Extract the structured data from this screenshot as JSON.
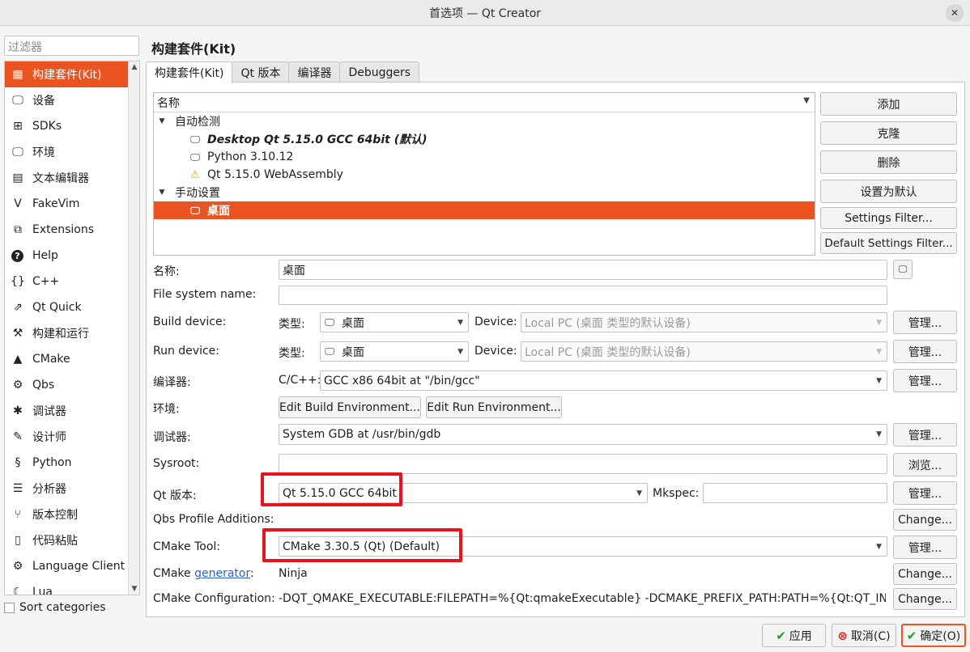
{
  "window": {
    "title": "首选项 — Qt Creator"
  },
  "sidebar": {
    "filter_placeholder": "过滤器",
    "items": [
      {
        "label": "构建套件(Kit)",
        "icon": "kit-icon",
        "selected": true
      },
      {
        "label": "设备",
        "icon": "device-icon"
      },
      {
        "label": "SDKs",
        "icon": "grid-icon"
      },
      {
        "label": "环境",
        "icon": "monitor-icon"
      },
      {
        "label": "文本编辑器",
        "icon": "text-editor-icon"
      },
      {
        "label": "FakeVim",
        "icon": "fakevim-icon"
      },
      {
        "label": "Extensions",
        "icon": "extensions-icon"
      },
      {
        "label": "Help",
        "icon": "help-icon"
      },
      {
        "label": "C++",
        "icon": "braces-icon"
      },
      {
        "label": "Qt Quick",
        "icon": "qtquick-icon"
      },
      {
        "label": "构建和运行",
        "icon": "hammer-icon"
      },
      {
        "label": "CMake",
        "icon": "cmake-icon"
      },
      {
        "label": "Qbs",
        "icon": "qbs-icon"
      },
      {
        "label": "调试器",
        "icon": "bug-icon"
      },
      {
        "label": "设计师",
        "icon": "pen-icon"
      },
      {
        "label": "Python",
        "icon": "python-icon"
      },
      {
        "label": "分析器",
        "icon": "analyzer-icon"
      },
      {
        "label": "版本控制",
        "icon": "version-control-icon"
      },
      {
        "label": "代码粘贴",
        "icon": "clipboard-icon"
      },
      {
        "label": "Language Client",
        "icon": "language-client-icon"
      },
      {
        "label": "Lua",
        "icon": "lua-icon"
      }
    ],
    "sort_label": "Sort categories"
  },
  "page": {
    "title": "构建套件(Kit)",
    "tabs": [
      "构建套件(Kit)",
      "Qt 版本",
      "编译器",
      "Debuggers"
    ]
  },
  "kits": {
    "header": "名称",
    "group_auto": "自动检测",
    "auto_items": [
      {
        "label": "Desktop Qt 5.15.0 GCC 64bit (默认)",
        "icon": "monitor-icon"
      },
      {
        "label": "Python 3.10.12",
        "icon": "monitor-icon"
      },
      {
        "label": "Qt 5.15.0 WebAssembly",
        "icon": "warning-icon"
      }
    ],
    "group_manual": "手动设置",
    "manual_items": [
      {
        "label": "桌面",
        "icon": "monitor-icon",
        "selected": true
      }
    ],
    "buttons": {
      "add": "添加",
      "clone": "克隆",
      "delete": "删除",
      "set_default": "设置为默认",
      "settings_filter": "Settings Filter...",
      "default_settings_filter": "Default Settings Filter..."
    }
  },
  "form": {
    "name_label": "名称:",
    "name_value": "桌面",
    "fs_label": "File system name:",
    "fs_value": "",
    "build_device_label": "Build device:",
    "run_device_label": "Run device:",
    "type_label": "类型:",
    "type_value": "桌面",
    "device_label": "Device:",
    "device_value": "Local PC (桌面 类型的默认设备)",
    "manage": "管理...",
    "compiler_label": "编译器:",
    "compiler_lang": "C/C++:",
    "compiler_value": "GCC x86 64bit at \"/bin/gcc\"",
    "env_label": "环境:",
    "edit_build_env": "Edit Build Environment...",
    "edit_run_env": "Edit Run Environment...",
    "debugger_label": "调试器:",
    "debugger_value": "System GDB at /usr/bin/gdb",
    "sysroot_label": "Sysroot:",
    "sysroot_value": "",
    "browse": "浏览...",
    "qt_label": "Qt 版本:",
    "qt_value": "Qt 5.15.0 GCC 64bit",
    "mkspec_label": "Mkspec:",
    "mkspec_value": "",
    "qbs_label": "Qbs Profile Additions:",
    "change": "Change...",
    "cmake_tool_label": "CMake Tool:",
    "cmake_tool_value": "CMake 3.30.5 (Qt) (Default)",
    "cmake_gen_label_prefix": "CMake ",
    "cmake_gen_link": "generator",
    "cmake_gen_suffix": ":",
    "cmake_gen_value": "Ninja",
    "cmake_config_label": "CMake Configuration:",
    "cmake_config_value": "-DQT_QMAKE_EXECUTABLE:FILEPATH=%{Qt:qmakeExecutable} -DCMAKE_PREFIX_PATH:PATH=%{Qt:QT_IN..."
  },
  "footer": {
    "apply": "应用",
    "cancel": "取消(C)",
    "ok": "确定(O)"
  },
  "colors": {
    "accent": "#e95420",
    "highlight_box": "#e8141b",
    "link": "#2a60c8"
  }
}
